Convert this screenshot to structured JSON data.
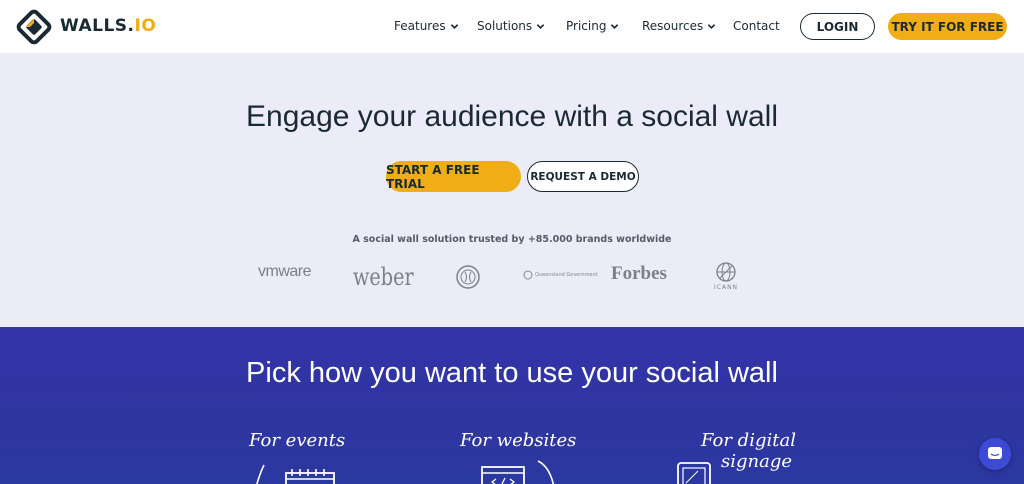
{
  "header": {
    "logo_text": "WALLS.",
    "logo_text_io": "IO",
    "nav": [
      {
        "label": "Features"
      },
      {
        "label": "Solutions"
      },
      {
        "label": "Pricing"
      },
      {
        "label": "Resources"
      },
      {
        "label": "Contact"
      }
    ],
    "login_label": "LOGIN",
    "try_label": "TRY IT FOR FREE"
  },
  "hero": {
    "title": "Engage your audience with a social wall",
    "trial_label": "START A FREE TRIAL",
    "demo_label": "REQUEST A DEMO",
    "trusted_text": "A social wall solution trusted by +85.000 brands worldwide",
    "brands": {
      "vmware": "vmware",
      "weber": "weber",
      "queensland": "Queensland Government",
      "forbes": "Forbes",
      "icann": "ICANN"
    }
  },
  "use_section": {
    "title": "Pick how you want to use your social wall",
    "options": [
      {
        "label": "For events"
      },
      {
        "label": "For websites"
      },
      {
        "label_line1": "For digital",
        "label_line2": "signage"
      }
    ]
  },
  "colors": {
    "accent": "#f0ad16",
    "dark": "#1a2a33",
    "hero_bg": "#ebecf7",
    "section_bg": "#2e35a0",
    "chat": "#3d4ad6"
  },
  "icons": [
    "walls-logo-icon",
    "chevron-down-icon",
    "chat-icon",
    "calendar-icon",
    "browser-code-icon",
    "tablet-icon"
  ]
}
